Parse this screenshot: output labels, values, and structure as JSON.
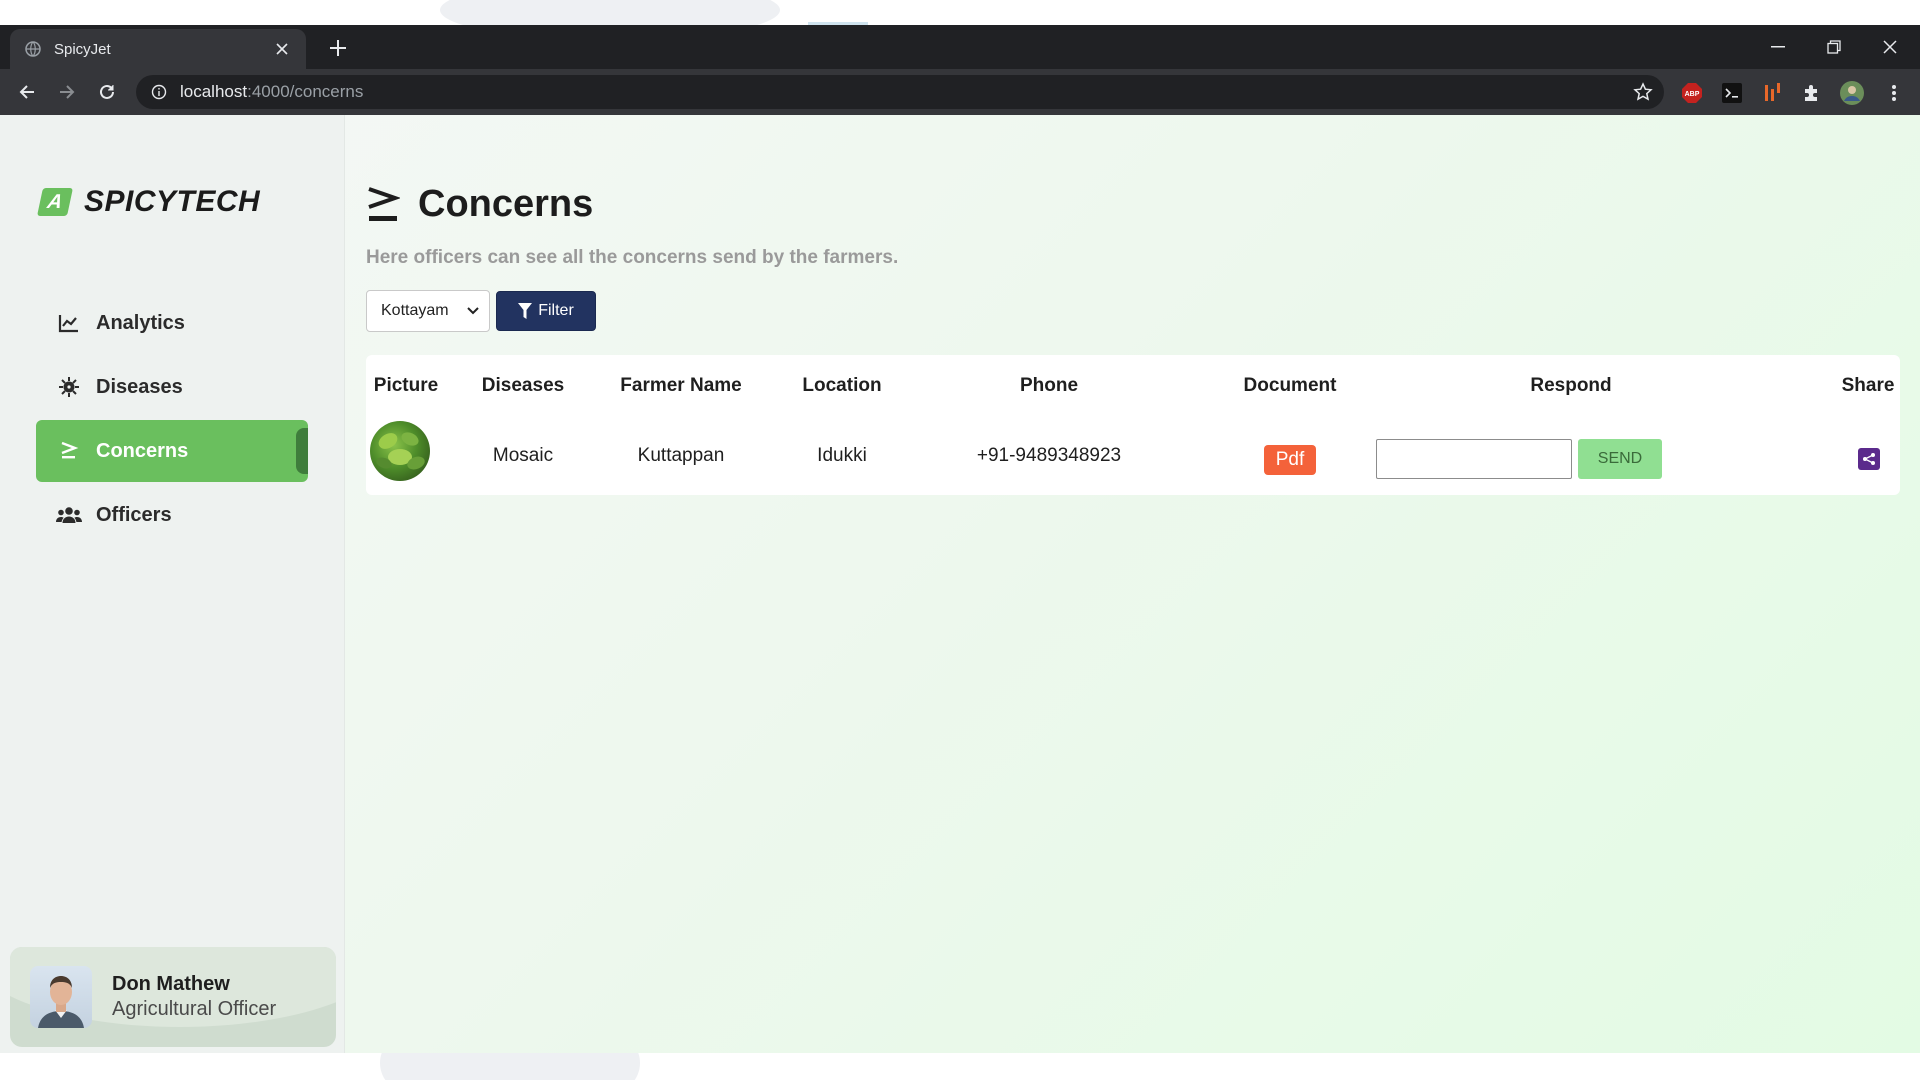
{
  "browser": {
    "tab_title": "SpicyJet",
    "url_host": "localhost",
    "url_path": ":4000/concerns"
  },
  "sidebar": {
    "brand": "SPICYTECH",
    "brand_mark": "A",
    "items": [
      {
        "label": "Analytics",
        "icon": "chart-line-icon",
        "active": false
      },
      {
        "label": "Diseases",
        "icon": "virus-icon",
        "active": false
      },
      {
        "label": "Concerns",
        "icon": "greater-equal-icon",
        "active": true
      },
      {
        "label": "Officers",
        "icon": "users-icon",
        "active": false
      }
    ],
    "profile": {
      "name": "Don Mathew",
      "role": "Agricultural Officer"
    }
  },
  "main": {
    "title": "Concerns",
    "subtitle": "Here officers can see all the concerns send by the farmers.",
    "filter": {
      "selected_location": "Kottayam",
      "button_label": "Filter"
    },
    "table": {
      "headers": [
        "Picture",
        "Diseases",
        "Farmer Name",
        "Location",
        "Phone",
        "Document",
        "Respond",
        "Share"
      ],
      "rows": [
        {
          "disease": "Mosaic",
          "farmer_name": "Kuttappan",
          "location": "Idukki",
          "phone": "+91-9489348923",
          "document_label": "Pdf",
          "respond_value": "",
          "send_label": "SEND"
        }
      ]
    }
  },
  "colors": {
    "accent_green": "#6abf5e",
    "filter_button": "#223360",
    "pdf_button": "#f4623a",
    "send_button": "#90df92",
    "share_button": "#5b2a8c"
  }
}
